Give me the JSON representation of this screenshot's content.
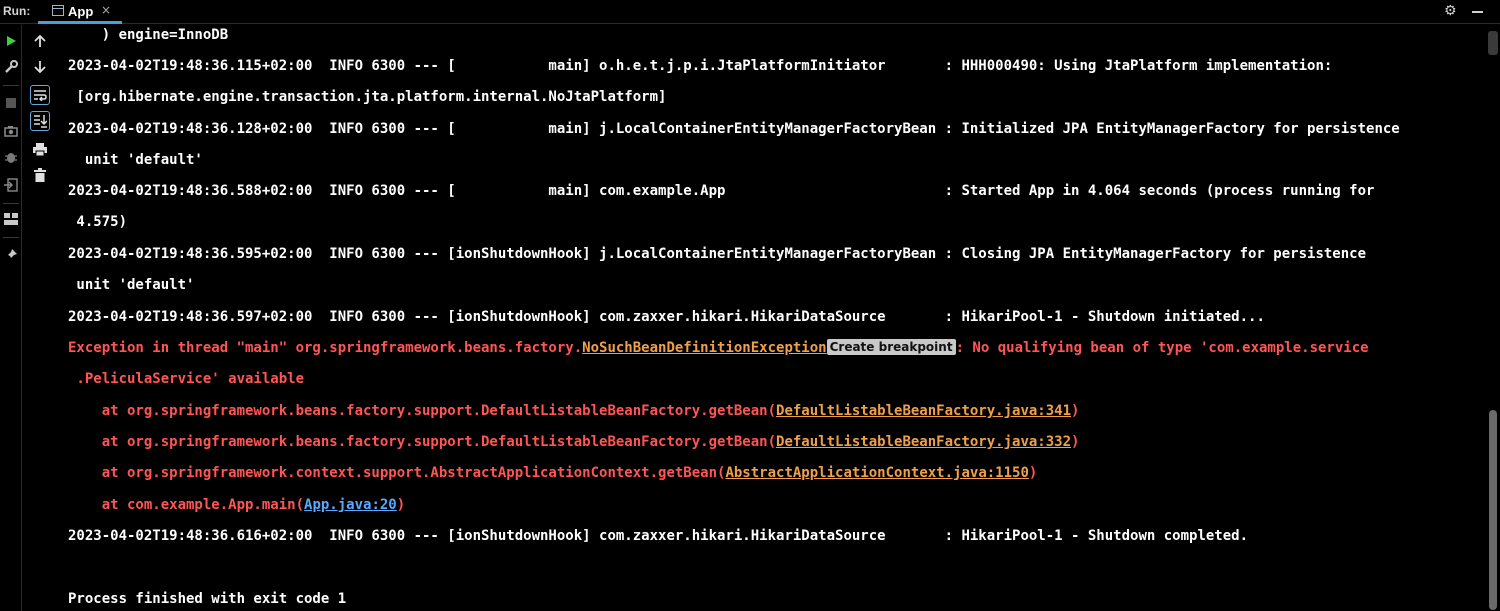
{
  "header": {
    "run_label": "Run:",
    "tab_label": "App",
    "tab_close": "×",
    "gear_glyph": "⚙"
  },
  "toolbar_icons": {
    "left": [
      "run-icon",
      "wrench-icon",
      "stop-icon",
      "camera-icon",
      "debug-icon",
      "exit-icon",
      "layout-icon",
      "pin-icon"
    ],
    "right": [
      "arrow-up-icon",
      "arrow-down-icon",
      "soft-wrap-icon",
      "scroll-to-end-icon",
      "print-icon",
      "trash-icon"
    ]
  },
  "console": {
    "lines": [
      "    ) engine=InnoDB",
      "2023-04-02T19:48:36.115+02:00  INFO 6300 --- [           main] o.h.e.t.j.p.i.JtaPlatformInitiator       : HHH000490: Using JtaPlatform implementation:",
      " [org.hibernate.engine.transaction.jta.platform.internal.NoJtaPlatform]",
      "2023-04-02T19:48:36.128+02:00  INFO 6300 --- [           main] j.LocalContainerEntityManagerFactoryBean : Initialized JPA EntityManagerFactory for persistence",
      "  unit 'default'",
      "2023-04-02T19:48:36.588+02:00  INFO 6300 --- [           main] com.example.App                          : Started App in 4.064 seconds (process running for",
      " 4.575)",
      "2023-04-02T19:48:36.595+02:00  INFO 6300 --- [ionShutdownHook] j.LocalContainerEntityManagerFactoryBean : Closing JPA EntityManagerFactory for persistence",
      " unit 'default'",
      "2023-04-02T19:48:36.597+02:00  INFO 6300 --- [ionShutdownHook] com.zaxxer.hikari.HikariDataSource       : HikariPool-1 - Shutdown initiated..."
    ],
    "exception": {
      "prefix": "Exception in thread \"main\" org.springframework.beans.factory.",
      "link": "NoSuchBeanDefinitionException",
      "badge": "Create breakpoint",
      "suffix": ": No qualifying bean of type 'com.example.service",
      "continuation": " .PeliculaService' available"
    },
    "stack": [
      {
        "prefix": "    at org.springframework.beans.factory.support.DefaultListableBeanFactory.getBean(",
        "link": "DefaultListableBeanFactory.java:341",
        "suffix": ")"
      },
      {
        "prefix": "    at org.springframework.beans.factory.support.DefaultListableBeanFactory.getBean(",
        "link": "DefaultListableBeanFactory.java:332",
        "suffix": ")"
      },
      {
        "prefix": "    at org.springframework.context.support.AbstractApplicationContext.getBean(",
        "link": "AbstractApplicationContext.java:1150",
        "suffix": ")"
      },
      {
        "prefix": "    at com.example.App.main(",
        "link": "App.java:20",
        "suffix": ")"
      }
    ],
    "shutdown_completed": "2023-04-02T19:48:36.616+02:00  INFO 6300 --- [ionShutdownHook] com.zaxxer.hikari.HikariDataSource       : HikariPool-1 - Shutdown completed.",
    "exit_line": "Process finished with exit code 1"
  },
  "colors": {
    "error": "#ff5555",
    "link_orange": "#f0a04b",
    "link_blue": "#5aa9ff",
    "run_green": "#3fcf3f"
  }
}
